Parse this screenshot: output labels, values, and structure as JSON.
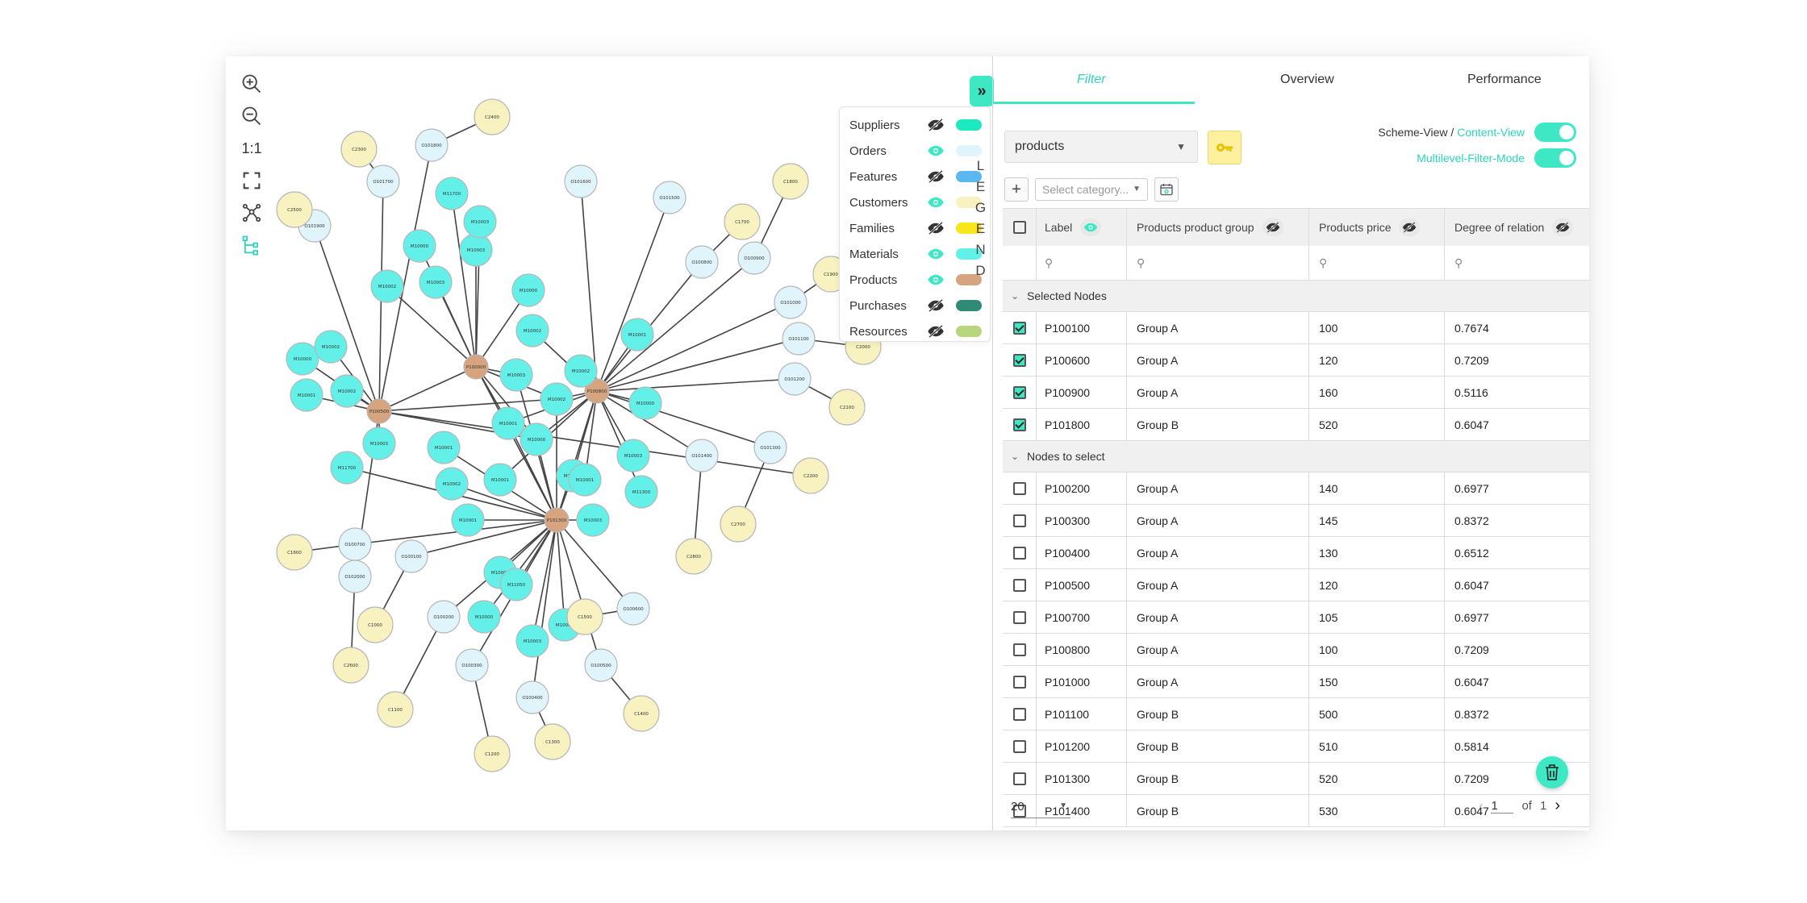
{
  "toolbar": {
    "zoom_in_icon": "zoom-in-icon",
    "zoom_out_icon": "zoom-out-icon",
    "ratio_label": "1:1",
    "fit_icon": "fit-screen-icon",
    "layout_icon": "graph-layout-icon",
    "tree_icon": "tree-layout-icon"
  },
  "graph": {
    "nodes": [
      {
        "id": "P",
        "label": "P101300",
        "type": "Products"
      },
      {
        "id": "Q",
        "label": "P100000",
        "type": "Products"
      },
      {
        "id": "R",
        "label": "P100800",
        "type": "Products"
      },
      {
        "id": "S",
        "label": "P100500",
        "type": "Products"
      },
      {
        "id": "m1",
        "label": "M10002",
        "type": "Materials"
      },
      {
        "id": "m2",
        "label": "M10003",
        "type": "Materials"
      },
      {
        "id": "m3",
        "label": "M11050",
        "type": "Materials"
      },
      {
        "id": "m4",
        "label": "M10001",
        "type": "Materials"
      },
      {
        "id": "m5",
        "label": "M10000",
        "type": "Materials"
      },
      {
        "id": "m6",
        "label": "M10003",
        "type": "Materials"
      },
      {
        "id": "m7",
        "label": "M10001",
        "type": "Materials"
      },
      {
        "id": "m8",
        "label": "M10002",
        "type": "Materials"
      },
      {
        "id": "m9",
        "label": "M10001",
        "type": "Materials"
      },
      {
        "id": "m10",
        "label": "M11700",
        "type": "Materials"
      },
      {
        "id": "m11",
        "label": "M10002",
        "type": "Materials"
      },
      {
        "id": "m12",
        "label": "M10001",
        "type": "Materials"
      },
      {
        "id": "m13",
        "label": "M10000",
        "type": "Materials"
      },
      {
        "id": "m14",
        "label": "M10002",
        "type": "Materials"
      },
      {
        "id": "m15",
        "label": "M10003",
        "type": "Materials"
      },
      {
        "id": "m16",
        "label": "M10003",
        "type": "Materials"
      },
      {
        "id": "m17",
        "label": "M10002",
        "type": "Materials"
      },
      {
        "id": "m18",
        "label": "M10000",
        "type": "Materials"
      },
      {
        "id": "m19",
        "label": "M10003",
        "type": "Materials"
      },
      {
        "id": "m20",
        "label": "M10000",
        "type": "Materials"
      },
      {
        "id": "m21",
        "label": "M11700",
        "type": "Materials"
      },
      {
        "id": "m22",
        "label": "M10003",
        "type": "Materials"
      },
      {
        "id": "m23",
        "label": "M10000",
        "type": "Materials"
      },
      {
        "id": "m24",
        "label": "M10001",
        "type": "Materials"
      },
      {
        "id": "m25",
        "label": "M10002",
        "type": "Materials"
      },
      {
        "id": "m26",
        "label": "M10002",
        "type": "Materials"
      },
      {
        "id": "m27",
        "label": "M10003",
        "type": "Materials"
      },
      {
        "id": "m28",
        "label": "M10001",
        "type": "Materials"
      },
      {
        "id": "m29",
        "label": "M11300",
        "type": "Materials"
      },
      {
        "id": "m30",
        "label": "M10001",
        "type": "Materials"
      },
      {
        "id": "m31",
        "label": "M10002",
        "type": "Materials"
      },
      {
        "id": "m32",
        "label": "M10000",
        "type": "Materials"
      },
      {
        "id": "m33",
        "label": "M10002",
        "type": "Materials"
      },
      {
        "id": "m34",
        "label": "M10003",
        "type": "Materials"
      },
      {
        "id": "m35",
        "label": "M10001",
        "type": "Materials"
      },
      {
        "id": "o1",
        "label": "O100100",
        "type": "Orders"
      },
      {
        "id": "o2",
        "label": "O100200",
        "type": "Orders"
      },
      {
        "id": "o3",
        "label": "O100300",
        "type": "Orders"
      },
      {
        "id": "o4",
        "label": "O100400",
        "type": "Orders"
      },
      {
        "id": "o5",
        "label": "O100500",
        "type": "Orders"
      },
      {
        "id": "o6",
        "label": "O100600",
        "type": "Orders"
      },
      {
        "id": "o7",
        "label": "O100700",
        "type": "Orders"
      },
      {
        "id": "o8",
        "label": "O100800",
        "type": "Orders"
      },
      {
        "id": "o9",
        "label": "O100900",
        "type": "Orders"
      },
      {
        "id": "o10",
        "label": "O101000",
        "type": "Orders"
      },
      {
        "id": "o11",
        "label": "O101100",
        "type": "Orders"
      },
      {
        "id": "o12",
        "label": "O101200",
        "type": "Orders"
      },
      {
        "id": "o13",
        "label": "O101300",
        "type": "Orders"
      },
      {
        "id": "o14",
        "label": "O101400",
        "type": "Orders"
      },
      {
        "id": "o15",
        "label": "O101500",
        "type": "Orders"
      },
      {
        "id": "o16",
        "label": "O101600",
        "type": "Orders"
      },
      {
        "id": "o17",
        "label": "O101700",
        "type": "Orders"
      },
      {
        "id": "o18",
        "label": "O101800",
        "type": "Orders"
      },
      {
        "id": "o19",
        "label": "O101900",
        "type": "Orders"
      },
      {
        "id": "o20",
        "label": "O102000",
        "type": "Orders"
      },
      {
        "id": "c1",
        "label": "C1000",
        "type": "Customers"
      },
      {
        "id": "c2",
        "label": "C1100",
        "type": "Customers"
      },
      {
        "id": "c3",
        "label": "C1200",
        "type": "Customers"
      },
      {
        "id": "c4",
        "label": "C1300",
        "type": "Customers"
      },
      {
        "id": "c5",
        "label": "C1400",
        "type": "Customers"
      },
      {
        "id": "c6",
        "label": "C1500",
        "type": "Customers"
      },
      {
        "id": "c7",
        "label": "C1600",
        "type": "Customers"
      },
      {
        "id": "c8",
        "label": "C1700",
        "type": "Customers"
      },
      {
        "id": "c9",
        "label": "C1800",
        "type": "Customers"
      },
      {
        "id": "c10",
        "label": "C1900",
        "type": "Customers"
      },
      {
        "id": "c11",
        "label": "C2000",
        "type": "Customers"
      },
      {
        "id": "c12",
        "label": "C2100",
        "type": "Customers"
      },
      {
        "id": "c13",
        "label": "C2200",
        "type": "Customers"
      },
      {
        "id": "c14",
        "label": "C2300",
        "type": "Customers"
      },
      {
        "id": "c15",
        "label": "C2400",
        "type": "Customers"
      },
      {
        "id": "c16",
        "label": "C2500",
        "type": "Customers"
      },
      {
        "id": "c17",
        "label": "C2600",
        "type": "Customers"
      },
      {
        "id": "c18",
        "label": "C2700",
        "type": "Customers"
      },
      {
        "id": "c19",
        "label": "C2800",
        "type": "Customers"
      }
    ],
    "edges": [
      [
        "P",
        "m1"
      ],
      [
        "P",
        "m2"
      ],
      [
        "P",
        "m3"
      ],
      [
        "P",
        "m4"
      ],
      [
        "P",
        "m5"
      ],
      [
        "P",
        "m6"
      ],
      [
        "P",
        "m7"
      ],
      [
        "P",
        "m8"
      ],
      [
        "P",
        "m9"
      ],
      [
        "P",
        "m10"
      ],
      [
        "P",
        "m11"
      ],
      [
        "P",
        "m12"
      ],
      [
        "P",
        "m13"
      ],
      [
        "P",
        "m14"
      ],
      [
        "P",
        "m15"
      ],
      [
        "P",
        "o1"
      ],
      [
        "P",
        "o2"
      ],
      [
        "P",
        "o3"
      ],
      [
        "P",
        "o4"
      ],
      [
        "P",
        "o5"
      ],
      [
        "P",
        "o6"
      ],
      [
        "P",
        "o7"
      ],
      [
        "P",
        "Q"
      ],
      [
        "P",
        "R"
      ],
      [
        "Q",
        "m16"
      ],
      [
        "Q",
        "m17"
      ],
      [
        "Q",
        "m18"
      ],
      [
        "Q",
        "m19"
      ],
      [
        "Q",
        "m20"
      ],
      [
        "Q",
        "m21"
      ],
      [
        "Q",
        "m22"
      ],
      [
        "Q",
        "m12"
      ],
      [
        "Q",
        "m13"
      ],
      [
        "Q",
        "m14"
      ],
      [
        "Q",
        "m15"
      ],
      [
        "Q",
        "S"
      ],
      [
        "R",
        "m23"
      ],
      [
        "R",
        "m24"
      ],
      [
        "R",
        "m25"
      ],
      [
        "R",
        "m26"
      ],
      [
        "R",
        "m27"
      ],
      [
        "R",
        "m28"
      ],
      [
        "R",
        "m29"
      ],
      [
        "R",
        "m14"
      ],
      [
        "R",
        "m13"
      ],
      [
        "R",
        "m12"
      ],
      [
        "R",
        "m30"
      ],
      [
        "R",
        "m11"
      ],
      [
        "R",
        "o8"
      ],
      [
        "R",
        "o9"
      ],
      [
        "R",
        "o10"
      ],
      [
        "R",
        "o11"
      ],
      [
        "R",
        "o12"
      ],
      [
        "R",
        "o13"
      ],
      [
        "R",
        "o14"
      ],
      [
        "R",
        "o15"
      ],
      [
        "R",
        "o16"
      ],
      [
        "S",
        "m31"
      ],
      [
        "S",
        "m32"
      ],
      [
        "S",
        "m33"
      ],
      [
        "S",
        "m34"
      ],
      [
        "S",
        "m35"
      ],
      [
        "S",
        "m14"
      ],
      [
        "S",
        "m13"
      ],
      [
        "S",
        "o17"
      ],
      [
        "S",
        "o18"
      ],
      [
        "S",
        "o19"
      ],
      [
        "S",
        "o20"
      ],
      [
        "S",
        "c13"
      ],
      [
        "o1",
        "c1"
      ],
      [
        "o2",
        "c2"
      ],
      [
        "o3",
        "c3"
      ],
      [
        "o4",
        "c4"
      ],
      [
        "o5",
        "c5"
      ],
      [
        "o6",
        "c6"
      ],
      [
        "o7",
        "c7"
      ],
      [
        "o8",
        "c8"
      ],
      [
        "o9",
        "c9"
      ],
      [
        "o10",
        "c10"
      ],
      [
        "o11",
        "c11"
      ],
      [
        "o12",
        "c12"
      ],
      [
        "o17",
        "c14"
      ],
      [
        "o18",
        "c15"
      ],
      [
        "o19",
        "c16"
      ],
      [
        "o20",
        "c17"
      ],
      [
        "o13",
        "c18"
      ],
      [
        "o14",
        "c19"
      ]
    ]
  },
  "legend": {
    "vertical_label": [
      "L",
      "E",
      "G",
      "E",
      "N",
      "D"
    ],
    "collapse_label": "»",
    "items": [
      {
        "label": "Suppliers",
        "visible": false,
        "color": "#1de9c0"
      },
      {
        "label": "Orders",
        "visible": true,
        "color": "#dff4fb"
      },
      {
        "label": "Features",
        "visible": false,
        "color": "#5ab8f0"
      },
      {
        "label": "Customers",
        "visible": true,
        "color": "#f7f2bf"
      },
      {
        "label": "Families",
        "visible": false,
        "color": "#f6e61b"
      },
      {
        "label": "Materials",
        "visible": true,
        "color": "#63f0e8"
      },
      {
        "label": "Products",
        "visible": true,
        "color": "#d6a47e"
      },
      {
        "label": "Purchases",
        "visible": false,
        "color": "#2f8a76"
      },
      {
        "label": "Resources",
        "visible": false,
        "color": "#b7d67d"
      }
    ]
  },
  "tabs": [
    {
      "label": "Filter",
      "active": true
    },
    {
      "label": "Overview",
      "active": false
    },
    {
      "label": "Performance",
      "active": false
    }
  ],
  "filter": {
    "entity_select": "products",
    "key_icon": "key-icon",
    "scheme_view_label": "Scheme-View /",
    "content_view_label": "Content-View",
    "multilevel_label": "Multilevel-Filter-Mode",
    "add_label": "+",
    "category_placeholder": "Select category...",
    "calendar_icon": "calendar-icon"
  },
  "table": {
    "columns": [
      "Label",
      "Products product group",
      "Products price",
      "Degree of relation"
    ],
    "groups": [
      {
        "title": "Selected Nodes",
        "rows": [
          {
            "checked": true,
            "label": "P100100",
            "group": "Group A",
            "price": "100",
            "degree": "0.7674"
          },
          {
            "checked": true,
            "label": "P100600",
            "group": "Group A",
            "price": "120",
            "degree": "0.7209"
          },
          {
            "checked": true,
            "label": "P100900",
            "group": "Group A",
            "price": "160",
            "degree": "0.5116"
          },
          {
            "checked": true,
            "label": "P101800",
            "group": "Group B",
            "price": "520",
            "degree": "0.6047"
          }
        ]
      },
      {
        "title": "Nodes to select",
        "rows": [
          {
            "checked": false,
            "label": "P100200",
            "group": "Group A",
            "price": "140",
            "degree": "0.6977"
          },
          {
            "checked": false,
            "label": "P100300",
            "group": "Group A",
            "price": "145",
            "degree": "0.8372"
          },
          {
            "checked": false,
            "label": "P100400",
            "group": "Group A",
            "price": "130",
            "degree": "0.6512"
          },
          {
            "checked": false,
            "label": "P100500",
            "group": "Group A",
            "price": "120",
            "degree": "0.6047"
          },
          {
            "checked": false,
            "label": "P100700",
            "group": "Group A",
            "price": "105",
            "degree": "0.6977"
          },
          {
            "checked": false,
            "label": "P100800",
            "group": "Group A",
            "price": "100",
            "degree": "0.7209"
          },
          {
            "checked": false,
            "label": "P101000",
            "group": "Group A",
            "price": "150",
            "degree": "0.6047"
          },
          {
            "checked": false,
            "label": "P101100",
            "group": "Group B",
            "price": "500",
            "degree": "0.8372"
          },
          {
            "checked": false,
            "label": "P101200",
            "group": "Group B",
            "price": "510",
            "degree": "0.5814"
          },
          {
            "checked": false,
            "label": "P101300",
            "group": "Group B",
            "price": "520",
            "degree": "0.7209"
          },
          {
            "checked": false,
            "label": "P101400",
            "group": "Group B",
            "price": "530",
            "degree": "0.6047"
          }
        ]
      }
    ]
  },
  "footer": {
    "page_size": "20",
    "page": "1",
    "of_label": "of",
    "total_pages": "1"
  }
}
